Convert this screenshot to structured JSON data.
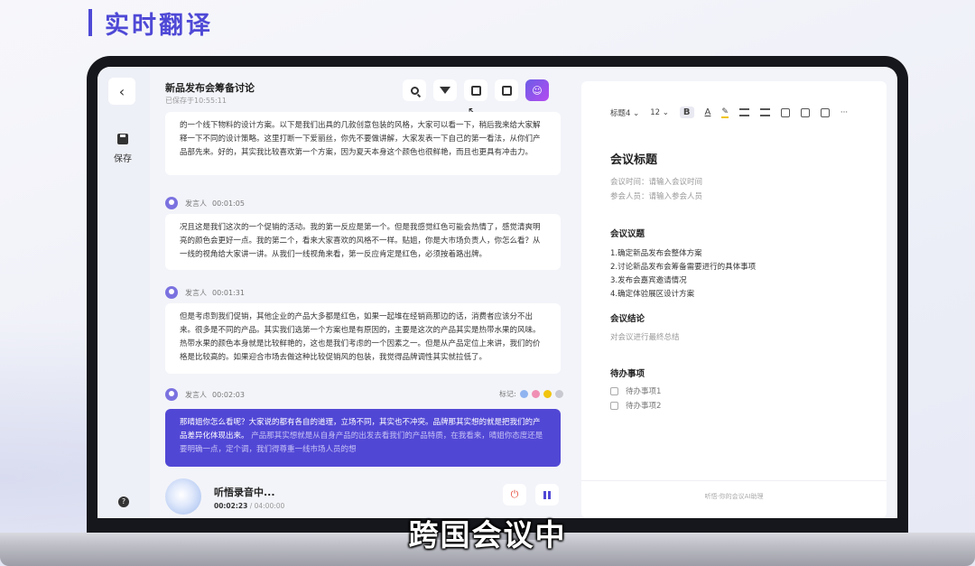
{
  "heading": "实时翻译",
  "rail": {
    "back_icon": "‹",
    "save_label": "保存",
    "help_icon": "?"
  },
  "document": {
    "title": "新品发布会筹备讨论",
    "saved": "已保存于10:55:11"
  },
  "toolbar": {
    "icons": [
      "search-icon",
      "filter-icon",
      "translate-icon",
      "text-icon",
      "ai-assistant-icon"
    ]
  },
  "transcript": {
    "first_text": "的一个线下物料的设计方案。以下是我们出具的几款创意包装的风格，大家可以看一下，稍后我来给大家解释一下不同的设计策略。这里打断一下爱丽丝，你先不要做讲解，大家发表一下自己的第一看法，从你们产品部先来。好的，其实我比较喜欢第一个方案，因为夏天本身这个颜色也很鲜艳，而且也更具有冲击力。",
    "entries": [
      {
        "speaker": "发言人",
        "time": "00:01:05",
        "text": "况且这是我们这次的一个促销的活动。我的第一反应是第一个。但是我感觉红色可能会热情了，感觉清爽明亮的颜色会更好一点。我的第二个，看来大家喜欢的风格不一样。贴姐，你是大市场负责人，你怎么看？从一线的视角给大家讲一讲。从我们一线视角来看，第一反应肯定是红色，必须按着路出牌。"
      },
      {
        "speaker": "发言人",
        "time": "00:01:31",
        "text": "但是考虑到我们促销，其他企业的产品大多都是红色，如果一起堆在经销商那边的话，消费者应该分不出来。很多是不同的产品。其实我们选第一个方案也是有原因的，主要是这次的产品其实是热带水果的风味。热带水果的颜色本身就是比较鲜艳的，这也是我们考虑的一个因素之一。但是从产品定位上来讲，我们的价格是比较高的。如果迎合市场去做这种比较促销风的包装，我觉得品牌调性其实就拉低了。"
      },
      {
        "speaker": "发言人",
        "time": "00:02:03",
        "text_main": "那晴姐你怎么看呢？大家说的都有各自的道理，立场不同，其实也不冲突。品牌那其实想的就是把我们的产品差异化体现出来。",
        "text_dim": "产品那其实想就是从自身产品的出发去看我们的产品特质，在我看来，晴姐你态度还是要明确一点，定个调，我们得尊重一线市场人员的想"
      }
    ],
    "marks_label": "标记:",
    "mark_colors": [
      "#8fb4f0",
      "#f08fb4",
      "#f1c40f",
      "#c9c9d1"
    ]
  },
  "recorder": {
    "status": "听悟录音中...",
    "elapsed": "00:02:23",
    "total": "/ 04:00:00"
  },
  "notes": {
    "toolbar": {
      "style": "标题4",
      "size": "12"
    },
    "title": "会议标题",
    "time_line": "会议时间：请输入会议时间",
    "people_line": "参会人员：请输入参会人员",
    "agenda_title": "会议议题",
    "agenda": [
      "1.确定新品发布会整体方案",
      "2.讨论新品发布会筹备需要进行的具体事项",
      "3.发布会嘉宾邀请情况",
      "4.确定体验展区设计方案"
    ],
    "conclusion_title": "会议结论",
    "conclusion_text": "对会议进行最终总结",
    "todo_title": "待办事项",
    "todos": [
      "待办事项1",
      "待办事项2"
    ],
    "footer": "听悟·你的会议AI助理"
  },
  "subtitle": "跨国会议中"
}
